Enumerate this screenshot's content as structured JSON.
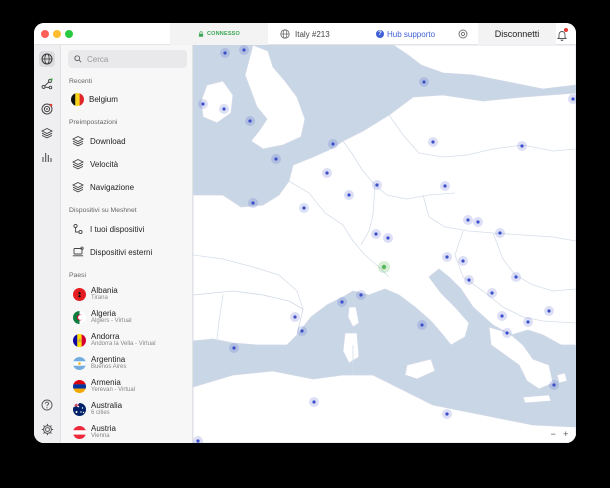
{
  "titlebar": {
    "status": "CONNESSO",
    "server": "Italy #213",
    "hub_label": "Hub supporto",
    "disconnect_label": "Disconnetti"
  },
  "search": {
    "placeholder": "Cerca"
  },
  "recent": {
    "heading": "Recenti",
    "items": [
      {
        "label": "Belgium"
      }
    ]
  },
  "presets": {
    "heading": "Preimpostazioni",
    "items": [
      {
        "label": "Download"
      },
      {
        "label": "Velocità"
      },
      {
        "label": "Navigazione"
      }
    ]
  },
  "meshnet": {
    "heading": "Dispositivi su Meshnet",
    "items": [
      {
        "label": "I tuoi dispositivi"
      },
      {
        "label": "Dispositivi esterni"
      }
    ]
  },
  "countries": {
    "heading": "Paesi",
    "items": [
      {
        "name": "Albania",
        "sub": "Tirana"
      },
      {
        "name": "Algeria",
        "sub": "Algiers - Virtual"
      },
      {
        "name": "Andorra",
        "sub": "Andorra la Vella - Virtual"
      },
      {
        "name": "Argentina",
        "sub": "Buenos Aires"
      },
      {
        "name": "Armenia",
        "sub": "Yerevan - Virtual"
      },
      {
        "name": "Australia",
        "sub": "6 cities"
      },
      {
        "name": "Austria",
        "sub": "Vienna"
      }
    ]
  },
  "map": {
    "zoom_out": "−",
    "zoom_in": "+"
  },
  "colors": {
    "land": "#ffffff",
    "sea": "#c9d6e6",
    "server_dot": "#3c50c8",
    "connected": "#5ab75a",
    "accent": "#3e5fd6"
  }
}
